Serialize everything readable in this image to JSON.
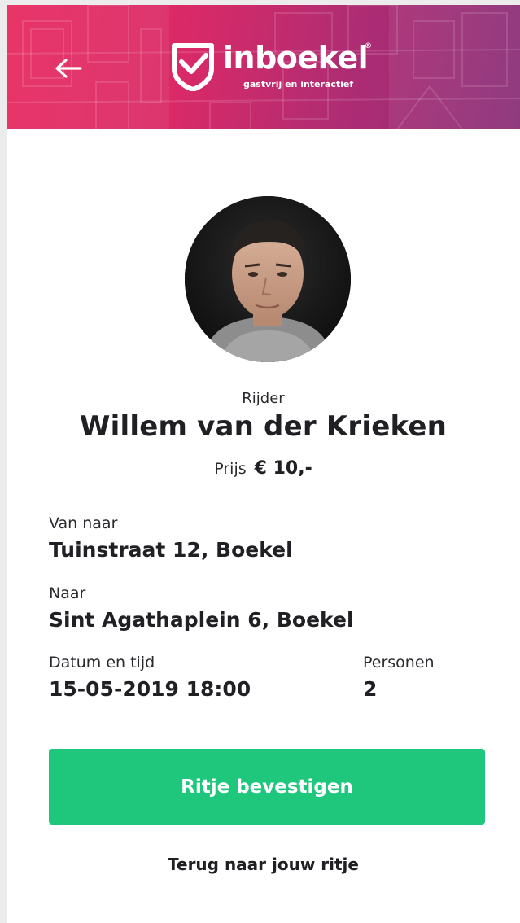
{
  "header": {
    "brand_name": "inboekel",
    "brand_tagline": "gastvrij en interactief",
    "registered_mark": "®"
  },
  "driver": {
    "role_label": "Rijder",
    "name": "Willem van der Krieken"
  },
  "price": {
    "label": "Prijs",
    "value": "€ 10,-"
  },
  "trip": {
    "from_label": "Van naar",
    "from_value": "Tuinstraat 12, Boekel",
    "to_label": "Naar",
    "to_value": "Sint Agathaplein 6, Boekel",
    "datetime_label": "Datum en tijd",
    "datetime_value": "15-05-2019 18:00",
    "persons_label": "Personen",
    "persons_value": "2"
  },
  "actions": {
    "confirm_label": "Ritje bevestigen",
    "back_label": "Terug naar jouw ritje"
  },
  "colors": {
    "accent_green": "#1ec77c",
    "header_pink": "#e8295f",
    "header_purple": "#8a2f78"
  },
  "icons": {
    "back": "arrow-left-icon",
    "logo": "inboekel-shield-logo-icon"
  }
}
